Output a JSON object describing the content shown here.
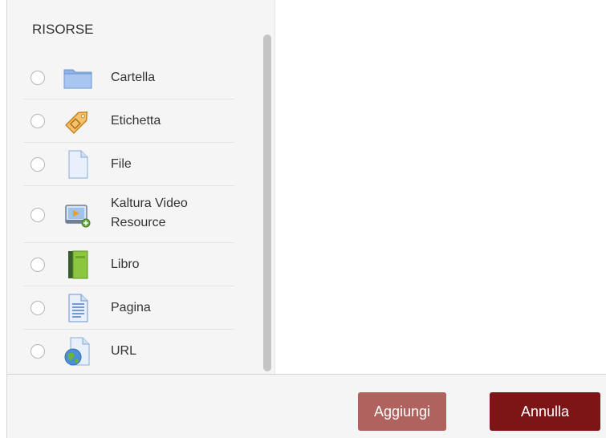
{
  "section": {
    "title": "RISORSE"
  },
  "options": [
    {
      "label": "Cartella",
      "icon": "folder-icon"
    },
    {
      "label": "Etichetta",
      "icon": "tag-icon"
    },
    {
      "label": "File",
      "icon": "file-icon"
    },
    {
      "label_line1": "Kaltura Video",
      "label_line2": "Resource",
      "icon": "video-resource-icon"
    },
    {
      "label": "Libro",
      "icon": "book-icon"
    },
    {
      "label": "Pagina",
      "icon": "page-icon"
    },
    {
      "label": "URL",
      "icon": "url-globe-icon"
    }
  ],
  "footer": {
    "add_label": "Aggiungi",
    "cancel_label": "Annulla"
  },
  "colors": {
    "add_button": "#b0625f",
    "cancel_button": "#7d1517",
    "panel_background": "#f5f5f5"
  }
}
